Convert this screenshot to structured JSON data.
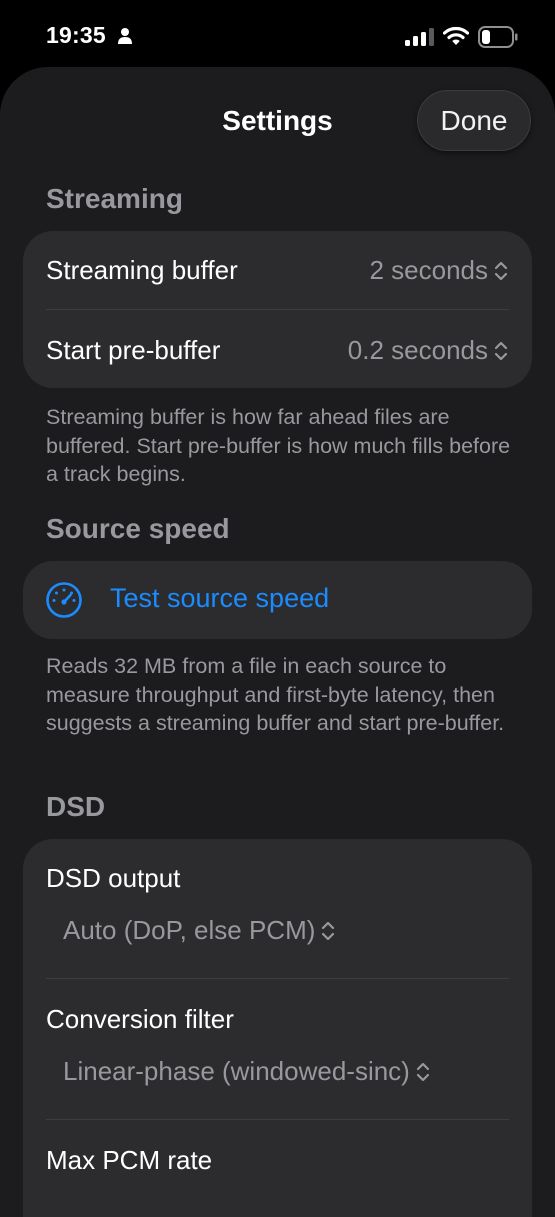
{
  "status_bar": {
    "time": "19:35",
    "icons": [
      "person-icon",
      "signal-icon",
      "wifi-icon",
      "battery-icon"
    ]
  },
  "header": {
    "title": "Settings",
    "done_label": "Done"
  },
  "streaming": {
    "header": "Streaming",
    "rows": [
      {
        "label": "Streaming buffer",
        "value": "2 seconds"
      },
      {
        "label": "Start pre-buffer",
        "value": "0.2 seconds"
      }
    ],
    "footnote": "Streaming buffer is how far ahead files are buffered. Start pre-buffer is how much fills before a track begins."
  },
  "source_speed": {
    "header": "Source speed",
    "action_label": "Test source speed",
    "icon": "speedometer-icon",
    "footnote": "Reads 32 MB from a file in each source to measure throughput and first-byte latency, then suggests a streaming buffer and start pre-buffer."
  },
  "dsd": {
    "header": "DSD",
    "rows": [
      {
        "label": "DSD output",
        "value": "Auto (DoP, else PCM)"
      },
      {
        "label": "Conversion filter",
        "value": "Linear-phase (windowed-sinc)"
      },
      {
        "label": "Max PCM rate",
        "value": ""
      }
    ]
  },
  "colors": {
    "background": "#000000",
    "sheet": "#1c1c1e",
    "card": "#2c2c2e",
    "secondary_text": "#98989f",
    "accent": "#1a8cff"
  }
}
